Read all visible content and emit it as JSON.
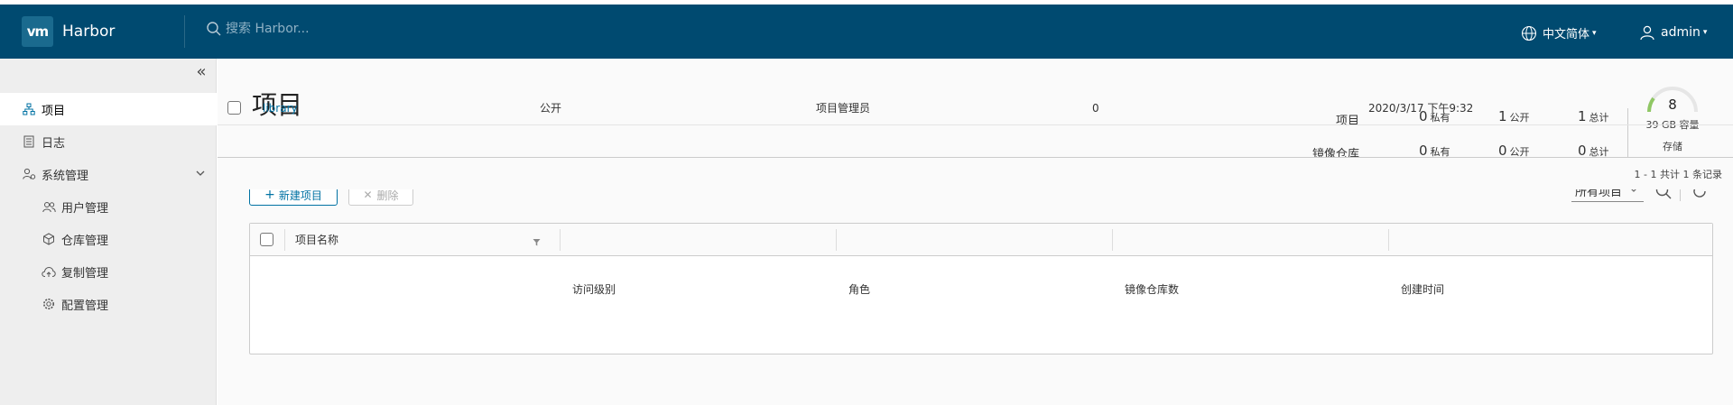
{
  "header": {
    "brand_logo": "vm",
    "brand_name": "Harbor",
    "search_placeholder": "搜索 Harbor...",
    "language": "中文简体",
    "user": "admin",
    "bg_color": "#004a70"
  },
  "sidebar": {
    "collapse_icon": "double-chevron-left-icon",
    "items": [
      {
        "label": "项目",
        "icon": "project-tree-icon",
        "active": true
      },
      {
        "label": "日志",
        "icon": "log-list-icon"
      },
      {
        "label": "系统管理",
        "icon": "admin-users-icon",
        "expanded": true
      },
      {
        "label": "用户管理",
        "icon": "users-icon",
        "sub": true
      },
      {
        "label": "仓库管理",
        "icon": "registry-cube-icon",
        "sub": true
      },
      {
        "label": "复制管理",
        "icon": "cloud-upload-icon",
        "sub": true
      },
      {
        "label": "配置管理",
        "icon": "gear-icon",
        "sub": true
      }
    ]
  },
  "main": {
    "title": "项目",
    "stats": {
      "projects_label": "项目",
      "repos_label": "镜像仓库",
      "projects": {
        "private": "0",
        "public": "1",
        "total": "1"
      },
      "repos": {
        "private": "0",
        "public": "0",
        "total": "0"
      },
      "private_label": "私有",
      "public_label": "公开",
      "total_label": "总计"
    },
    "storage": {
      "value": "8",
      "text": "39 GB 容量",
      "label": "存储"
    },
    "buttons": {
      "new_project": "新建项目",
      "delete": "删除"
    },
    "filter": {
      "selected": "所有项目"
    },
    "table": {
      "headers": [
        "项目名称",
        "访问级别",
        "角色",
        "镜像仓库数",
        "创建时间"
      ],
      "rows": [
        {
          "name": "library",
          "access": "公开",
          "role": "项目管理员",
          "repo_count": "0",
          "created": "2020/3/17 下午9:32"
        }
      ],
      "footer": "1 - 1 共计 1 条记录"
    }
  }
}
